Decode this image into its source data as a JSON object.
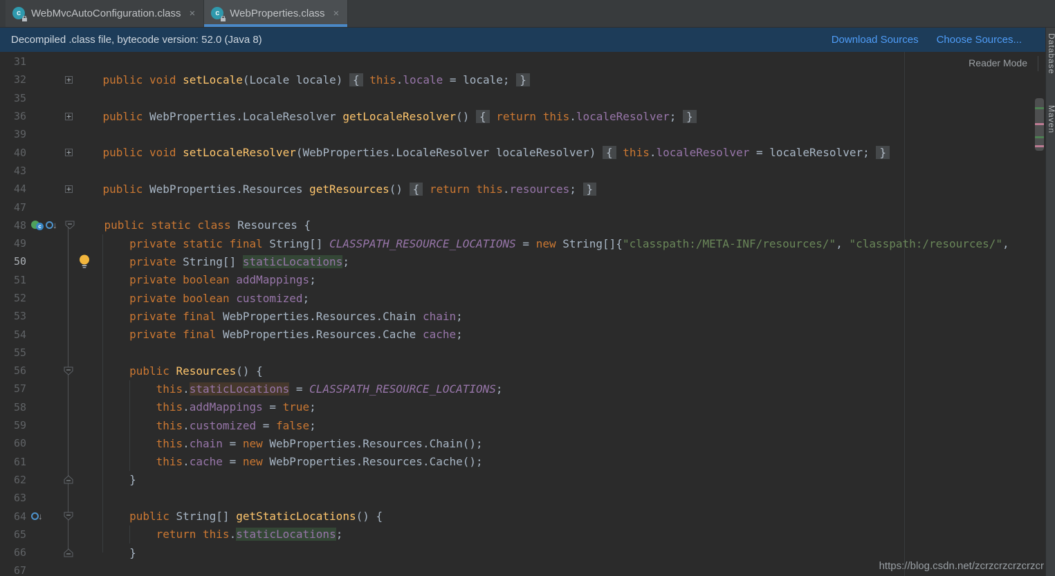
{
  "window": {
    "tabs": [
      {
        "label": "WebMvcAutoConfiguration.class",
        "close_glyph": "×",
        "active": false
      },
      {
        "label": "WebProperties.class",
        "close_glyph": "×",
        "active": true
      }
    ]
  },
  "banner": {
    "message": "Decompiled .class file, bytecode version: 52.0 (Java 8)",
    "links": [
      {
        "label": "Download Sources"
      },
      {
        "label": "Choose Sources..."
      }
    ]
  },
  "editor": {
    "reader_mode_label": "Reader Mode",
    "watermark": "https://blog.csdn.net/zcrzcrzcrzcrzcr",
    "lines": [
      {
        "num": "31",
        "tokens": []
      },
      {
        "num": "32",
        "fold": "plus",
        "tokens": [
          [
            "t",
            "    "
          ],
          [
            "k",
            "public"
          ],
          [
            "t",
            " "
          ],
          [
            "k",
            "void"
          ],
          [
            "t",
            " "
          ],
          [
            "m",
            "setLocale"
          ],
          [
            "t",
            "(Locale locale) "
          ],
          [
            "fb",
            "{"
          ],
          [
            "t",
            " "
          ],
          [
            "k",
            "this"
          ],
          [
            "t",
            "."
          ],
          [
            "f",
            "locale"
          ],
          [
            "t",
            " = locale; "
          ],
          [
            "fb",
            "}"
          ]
        ]
      },
      {
        "num": "35",
        "tokens": []
      },
      {
        "num": "36",
        "fold": "plus",
        "tokens": [
          [
            "t",
            "    "
          ],
          [
            "k",
            "public"
          ],
          [
            "t",
            " WebProperties.LocaleResolver "
          ],
          [
            "m",
            "getLocaleResolver"
          ],
          [
            "t",
            "() "
          ],
          [
            "fb",
            "{"
          ],
          [
            "t",
            " "
          ],
          [
            "k",
            "return"
          ],
          [
            "t",
            " "
          ],
          [
            "k",
            "this"
          ],
          [
            "t",
            "."
          ],
          [
            "f",
            "localeResolver"
          ],
          [
            "t",
            "; "
          ],
          [
            "fb",
            "}"
          ]
        ]
      },
      {
        "num": "39",
        "tokens": []
      },
      {
        "num": "40",
        "fold": "plus",
        "tokens": [
          [
            "t",
            "    "
          ],
          [
            "k",
            "public"
          ],
          [
            "t",
            " "
          ],
          [
            "k",
            "void"
          ],
          [
            "t",
            " "
          ],
          [
            "m",
            "setLocaleResolver"
          ],
          [
            "t",
            "(WebProperties.LocaleResolver localeResolver) "
          ],
          [
            "fb",
            "{"
          ],
          [
            "t",
            " "
          ],
          [
            "k",
            "this"
          ],
          [
            "t",
            "."
          ],
          [
            "f",
            "localeResolver"
          ],
          [
            "t",
            " = localeResolver; "
          ],
          [
            "fb",
            "}"
          ]
        ]
      },
      {
        "num": "43",
        "tokens": []
      },
      {
        "num": "44",
        "fold": "plus",
        "tokens": [
          [
            "t",
            "    "
          ],
          [
            "k",
            "public"
          ],
          [
            "t",
            " WebProperties.Resources "
          ],
          [
            "m",
            "getResources"
          ],
          [
            "t",
            "() "
          ],
          [
            "fb",
            "{"
          ],
          [
            "t",
            " "
          ],
          [
            "k",
            "return"
          ],
          [
            "t",
            " "
          ],
          [
            "k",
            "this"
          ],
          [
            "t",
            "."
          ],
          [
            "f",
            "resources"
          ],
          [
            "t",
            "; "
          ],
          [
            "fb",
            "}"
          ]
        ]
      },
      {
        "num": "47",
        "tokens": []
      },
      {
        "num": "48",
        "fold": "open",
        "icons": [
          "class-icon",
          "overridden-marker-icon"
        ],
        "tokens": [
          [
            "t",
            "    "
          ],
          [
            "k",
            "public"
          ],
          [
            "t",
            " "
          ],
          [
            "k",
            "static"
          ],
          [
            "t",
            " "
          ],
          [
            "k",
            "class"
          ],
          [
            "t",
            " Resources {"
          ]
        ]
      },
      {
        "num": "49",
        "tokens": [
          [
            "t",
            "        "
          ],
          [
            "k",
            "private"
          ],
          [
            "t",
            " "
          ],
          [
            "k",
            "static"
          ],
          [
            "t",
            " "
          ],
          [
            "k",
            "final"
          ],
          [
            "t",
            " String[] "
          ],
          [
            "sf",
            "CLASSPATH_RESOURCE_LOCATIONS"
          ],
          [
            "t",
            " = "
          ],
          [
            "k",
            "new"
          ],
          [
            "t",
            " String[]{"
          ],
          [
            "s",
            "\"classpath:/META-INF/resources/\""
          ],
          [
            "t",
            ", "
          ],
          [
            "s",
            "\"classpath:/resources/\""
          ],
          [
            "t",
            ","
          ]
        ]
      },
      {
        "num": "50",
        "current": true,
        "bulb": true,
        "tokens": [
          [
            "t",
            "        "
          ],
          [
            "k",
            "private"
          ],
          [
            "t",
            " String[] "
          ],
          [
            "f hg",
            "staticLocations"
          ],
          [
            "t",
            ";"
          ]
        ]
      },
      {
        "num": "51",
        "tokens": [
          [
            "t",
            "        "
          ],
          [
            "k",
            "private"
          ],
          [
            "t",
            " "
          ],
          [
            "k",
            "boolean"
          ],
          [
            "t",
            " "
          ],
          [
            "f",
            "addMappings"
          ],
          [
            "t",
            ";"
          ]
        ]
      },
      {
        "num": "52",
        "tokens": [
          [
            "t",
            "        "
          ],
          [
            "k",
            "private"
          ],
          [
            "t",
            " "
          ],
          [
            "k",
            "boolean"
          ],
          [
            "t",
            " "
          ],
          [
            "f",
            "customized"
          ],
          [
            "t",
            ";"
          ]
        ]
      },
      {
        "num": "53",
        "tokens": [
          [
            "t",
            "        "
          ],
          [
            "k",
            "private"
          ],
          [
            "t",
            " "
          ],
          [
            "k",
            "final"
          ],
          [
            "t",
            " WebProperties.Resources.Chain "
          ],
          [
            "f",
            "chain"
          ],
          [
            "t",
            ";"
          ]
        ]
      },
      {
        "num": "54",
        "tokens": [
          [
            "t",
            "        "
          ],
          [
            "k",
            "private"
          ],
          [
            "t",
            " "
          ],
          [
            "k",
            "final"
          ],
          [
            "t",
            " WebProperties.Resources.Cache "
          ],
          [
            "f",
            "cache"
          ],
          [
            "t",
            ";"
          ]
        ]
      },
      {
        "num": "55",
        "tokens": []
      },
      {
        "num": "56",
        "fold": "open",
        "tokens": [
          [
            "t",
            "        "
          ],
          [
            "k",
            "public"
          ],
          [
            "t",
            " "
          ],
          [
            "m",
            "Resources"
          ],
          [
            "t",
            "() {"
          ]
        ]
      },
      {
        "num": "57",
        "tokens": [
          [
            "t",
            "            "
          ],
          [
            "k",
            "this"
          ],
          [
            "t",
            "."
          ],
          [
            "f hw",
            "staticLocations"
          ],
          [
            "t",
            " = "
          ],
          [
            "sf",
            "CLASSPATH_RESOURCE_LOCATIONS"
          ],
          [
            "t",
            ";"
          ]
        ]
      },
      {
        "num": "58",
        "tokens": [
          [
            "t",
            "            "
          ],
          [
            "k",
            "this"
          ],
          [
            "t",
            "."
          ],
          [
            "f",
            "addMappings"
          ],
          [
            "t",
            " = "
          ],
          [
            "k",
            "true"
          ],
          [
            "t",
            ";"
          ]
        ]
      },
      {
        "num": "59",
        "tokens": [
          [
            "t",
            "            "
          ],
          [
            "k",
            "this"
          ],
          [
            "t",
            "."
          ],
          [
            "f",
            "customized"
          ],
          [
            "t",
            " = "
          ],
          [
            "k",
            "false"
          ],
          [
            "t",
            ";"
          ]
        ]
      },
      {
        "num": "60",
        "tokens": [
          [
            "t",
            "            "
          ],
          [
            "k",
            "this"
          ],
          [
            "t",
            "."
          ],
          [
            "f",
            "chain"
          ],
          [
            "t",
            " = "
          ],
          [
            "k",
            "new"
          ],
          [
            "t",
            " WebProperties.Resources.Chain();"
          ]
        ]
      },
      {
        "num": "61",
        "tokens": [
          [
            "t",
            "            "
          ],
          [
            "k",
            "this"
          ],
          [
            "t",
            "."
          ],
          [
            "f",
            "cache"
          ],
          [
            "t",
            " = "
          ],
          [
            "k",
            "new"
          ],
          [
            "t",
            " WebProperties.Resources.Cache();"
          ]
        ]
      },
      {
        "num": "62",
        "fold": "close",
        "tokens": [
          [
            "t",
            "        }"
          ]
        ]
      },
      {
        "num": "63",
        "tokens": []
      },
      {
        "num": "64",
        "fold": "open",
        "icons": [
          "overridden-marker-icon"
        ],
        "tokens": [
          [
            "t",
            "        "
          ],
          [
            "k",
            "public"
          ],
          [
            "t",
            " String[] "
          ],
          [
            "m",
            "getStaticLocations"
          ],
          [
            "t",
            "() {"
          ]
        ]
      },
      {
        "num": "65",
        "tokens": [
          [
            "t",
            "            "
          ],
          [
            "k",
            "return"
          ],
          [
            "t",
            " "
          ],
          [
            "k",
            "this"
          ],
          [
            "t",
            "."
          ],
          [
            "f hg",
            "staticLocations"
          ],
          [
            "t",
            ";"
          ]
        ]
      },
      {
        "num": "66",
        "fold": "close",
        "tokens": [
          [
            "t",
            "        }"
          ]
        ]
      },
      {
        "num": "67",
        "tokens": []
      }
    ]
  },
  "tool_windows": {
    "right_labels": [
      "Database",
      "Maven"
    ]
  },
  "colors": {
    "editor_bg": "#2b2b2b",
    "tabbar_bg": "#383b3d",
    "active_tab_underline": "#4a88c7",
    "banner_bg": "#1d3c59",
    "link_blue": "#4f9df8",
    "keyword_orange": "#cc7832",
    "method_yellow": "#ffc66d",
    "field_purple": "#9876aa",
    "string_green": "#6a8759",
    "scroll_mark_green": "#4d8052",
    "scroll_mark_pink": "#bd7b93"
  }
}
